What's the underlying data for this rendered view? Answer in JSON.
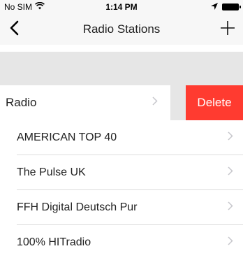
{
  "status_bar": {
    "carrier": "No SIM",
    "time": "1:14 PM"
  },
  "nav": {
    "title": "Radio Stations"
  },
  "swiped_row": {
    "label": "Radio",
    "delete_label": "Delete"
  },
  "stations": [
    {
      "name": "AMERICAN TOP 40"
    },
    {
      "name": "The Pulse UK"
    },
    {
      "name": "FFH Digital Deutsch Pur"
    },
    {
      "name": "100% HITradio"
    }
  ],
  "colors": {
    "delete": "#ff3b30",
    "chevron": "#c7c7cc",
    "section_background": "#e6e6e6"
  }
}
